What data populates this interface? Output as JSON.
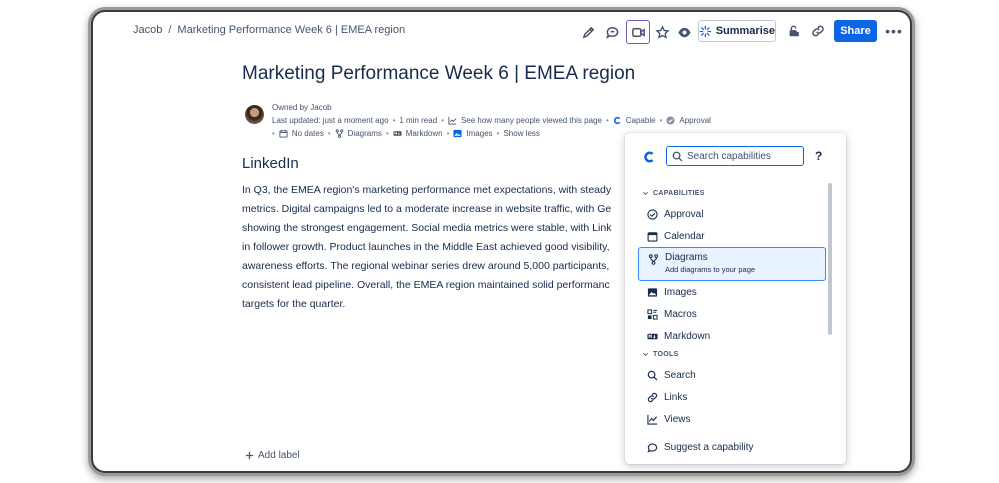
{
  "breadcrumb": {
    "root": "Jacob",
    "separator": "/",
    "page": "Marketing Performance Week 6 | EMEA region"
  },
  "toolbar": {
    "summarise_label": "Summarise",
    "share_label": "Share",
    "more_label": "•••"
  },
  "page": {
    "title": "Marketing Performance Week 6 | EMEA region",
    "owned_by": "Owned by Jacob",
    "last_updated": "Last updated: just a moment ago",
    "read_time": "1 min read",
    "views_text": "See how many people viewed this page",
    "capable": "Capable",
    "approval": "Approval",
    "no_dates": "No dates",
    "diagrams": "Diagrams",
    "markdown": "Markdown",
    "images": "Images",
    "show_less": "Show less",
    "section_heading": "LinkedIn",
    "paragraph_lines": [
      "In Q3, the EMEA region's marketing performance met expectations, with steady",
      "metrics. Digital campaigns led to a moderate increase in website traffic, with Ge",
      "showing the strongest engagement. Social media metrics were stable, with Link",
      "in follower growth. Product launches in the Middle East achieved good visibility,",
      "awareness efforts. The regional webinar series drew around 5,000 participants,",
      "consistent lead pipeline. Overall, the EMEA region maintained solid performanc",
      "targets for the quarter."
    ],
    "add_label": "Add label"
  },
  "capabilities_popover": {
    "search_placeholder": "Search capabilities",
    "help": "?",
    "capabilities_header": "CAPABILITIES",
    "tools_header": "TOOLS",
    "items": [
      {
        "label": "Approval"
      },
      {
        "label": "Calendar"
      },
      {
        "label": "Diagrams",
        "sub": "Add diagrams to your page"
      },
      {
        "label": "Images"
      },
      {
        "label": "Macros"
      },
      {
        "label": "Markdown"
      }
    ],
    "tools": [
      {
        "label": "Search"
      },
      {
        "label": "Links"
      },
      {
        "label": "Views"
      }
    ],
    "suggest": "Suggest a capability"
  },
  "colors": {
    "accent": "#0c66e4",
    "active_outline": "#6e5dc6",
    "text": "#172b4d",
    "subtle": "#44546f"
  }
}
